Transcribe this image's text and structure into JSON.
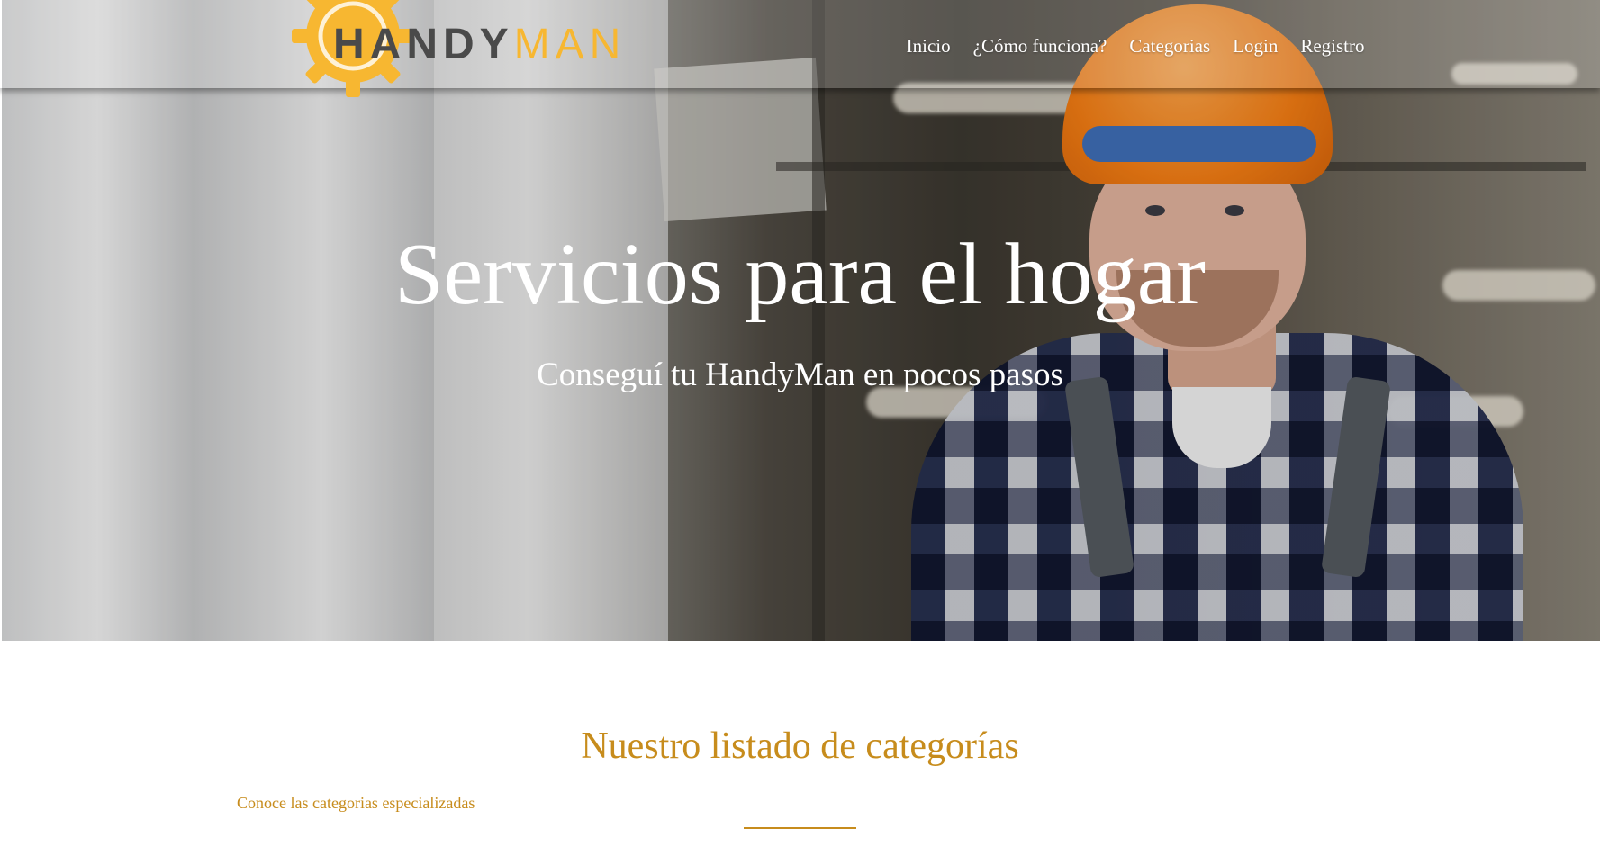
{
  "header": {
    "logo": {
      "text_dark": "HANDY",
      "text_gold": "MAN"
    },
    "nav": [
      {
        "label": "Inicio"
      },
      {
        "label": "¿Cómo funciona?"
      },
      {
        "label": "Categorias"
      },
      {
        "label": "Login"
      },
      {
        "label": "Registro"
      }
    ]
  },
  "hero": {
    "title": "Servicios para el hogar",
    "subtitle": "Conseguí tu HandyMan en pocos pasos"
  },
  "categories": {
    "title": "Nuestro listado de categorías",
    "subtitle": "Conoce las categorias especializadas"
  },
  "colors": {
    "brand_gold": "#f7b731",
    "accent": "#c78c1c",
    "logo_dark": "#4a4a4a"
  }
}
